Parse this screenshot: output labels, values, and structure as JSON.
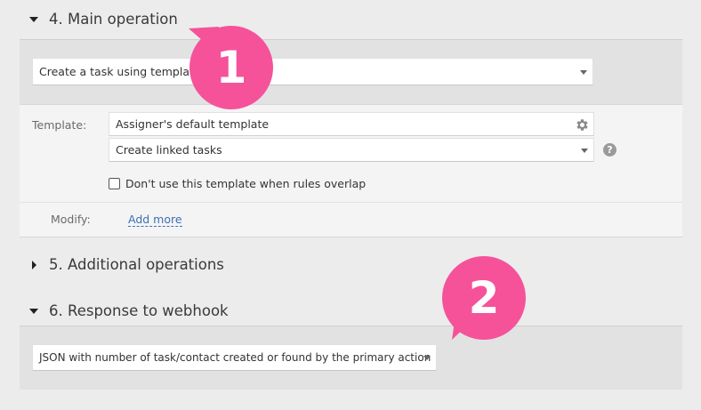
{
  "sections": {
    "main_operation": {
      "title": "4. Main operation",
      "expanded": true
    },
    "additional_operations": {
      "title": "5. Additional operations",
      "expanded": false
    },
    "response_webhook": {
      "title": "6. Response to webhook",
      "expanded": true
    }
  },
  "main_operation": {
    "action_select": {
      "value": "Create a task using template"
    },
    "template_label": "Template:",
    "template_field": {
      "value": "Assigner's default template",
      "icon": "gear-icon"
    },
    "linked_select": {
      "value": "Create linked tasks"
    },
    "help_icon": {
      "glyph": "?"
    },
    "overlap_checkbox": {
      "label": "Don't use this template when rules overlap",
      "checked": false
    },
    "modify_label": "Modify:",
    "add_more_link": "Add more"
  },
  "response_webhook": {
    "response_select": {
      "value": "JSON with number of task/contact created or found by the primary action"
    }
  },
  "callouts": [
    {
      "number": "1",
      "color": "#f5529a"
    },
    {
      "number": "2",
      "color": "#f5529a"
    }
  ]
}
